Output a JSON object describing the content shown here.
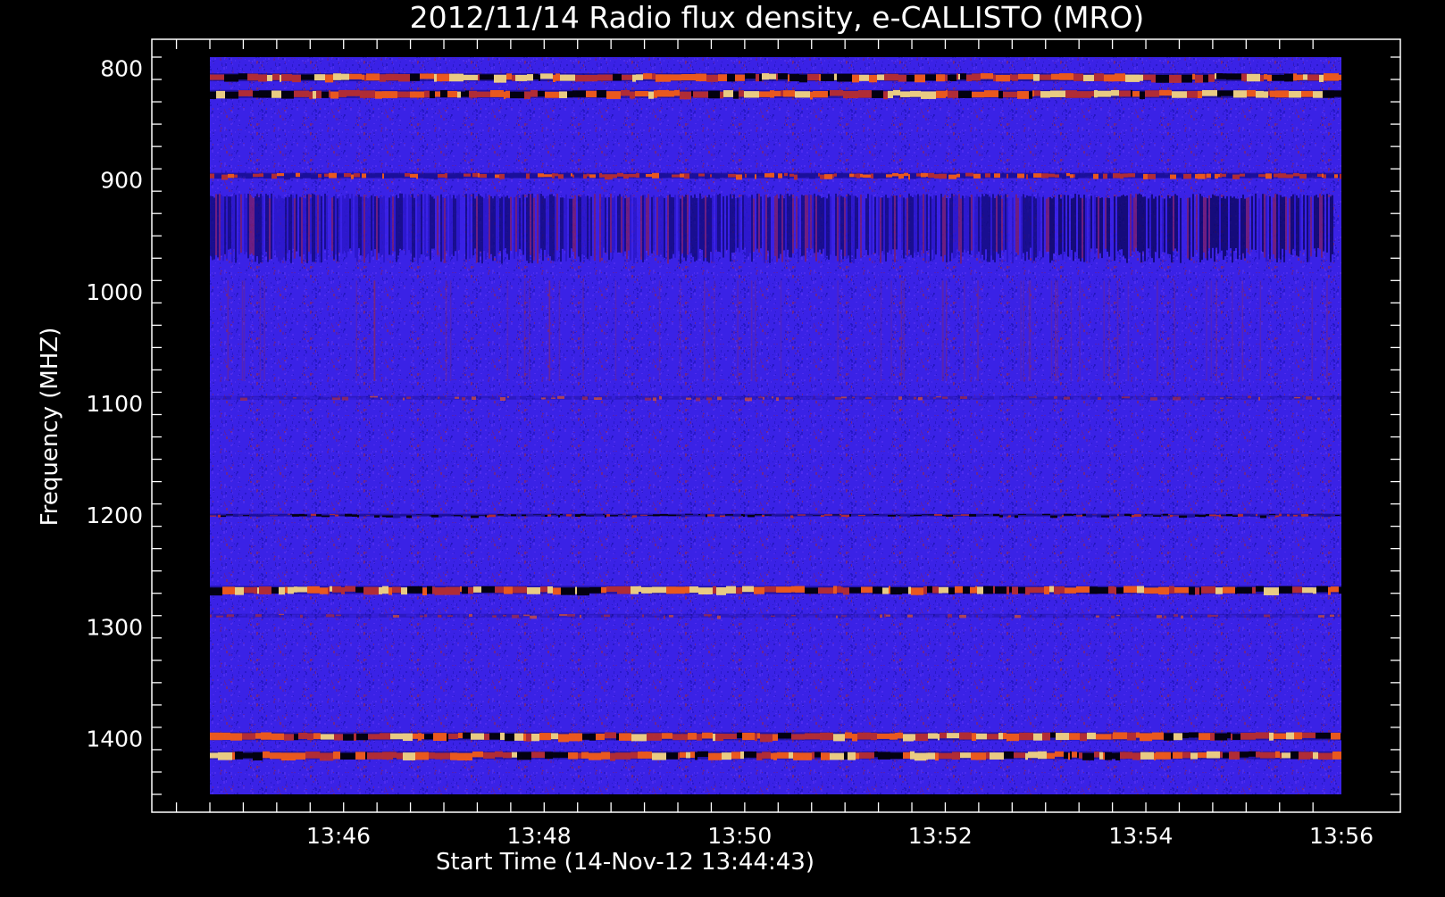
{
  "chart_data": {
    "type": "heatmap",
    "title": "2012/11/14  Radio flux density, e-CALLISTO (MRO)",
    "xlabel": "Start Time (14-Nov-12 13:44:43)",
    "ylabel": "Frequency (MHZ)",
    "x_range": [
      "13:44:43",
      "13:56:00"
    ],
    "x_ticks": [
      {
        "label": "13:46",
        "minutes": 1.283
      },
      {
        "label": "13:48",
        "minutes": 3.283
      },
      {
        "label": "13:50",
        "minutes": 5.283
      },
      {
        "label": "13:52",
        "minutes": 7.283
      },
      {
        "label": "13:54",
        "minutes": 9.283
      },
      {
        "label": "13:56",
        "minutes": 11.283
      }
    ],
    "y_range_mhz": [
      790,
      1450
    ],
    "y_axis_inverted": true,
    "y_ticks": [
      800,
      900,
      1000,
      1100,
      1200,
      1300,
      1400
    ],
    "colormap": [
      "#000000",
      "#1a0f9a",
      "#3b1eea",
      "#c0302a",
      "#ff6010",
      "#ffe080"
    ],
    "background_color": "#3a22e6",
    "frame_color": "#ffffff",
    "emission_bands_mhz": [
      {
        "freq": 808,
        "intensity": "strong"
      },
      {
        "freq": 823,
        "intensity": "strong"
      },
      {
        "freq": 896,
        "intensity": "medium"
      },
      {
        "freq": 940,
        "intensity": "striated"
      },
      {
        "freq": 1095,
        "intensity": "weak"
      },
      {
        "freq": 1200,
        "intensity": "line"
      },
      {
        "freq": 1267,
        "intensity": "strong"
      },
      {
        "freq": 1290,
        "intensity": "weak"
      },
      {
        "freq": 1398,
        "intensity": "strong"
      },
      {
        "freq": 1415,
        "intensity": "strong"
      }
    ]
  }
}
